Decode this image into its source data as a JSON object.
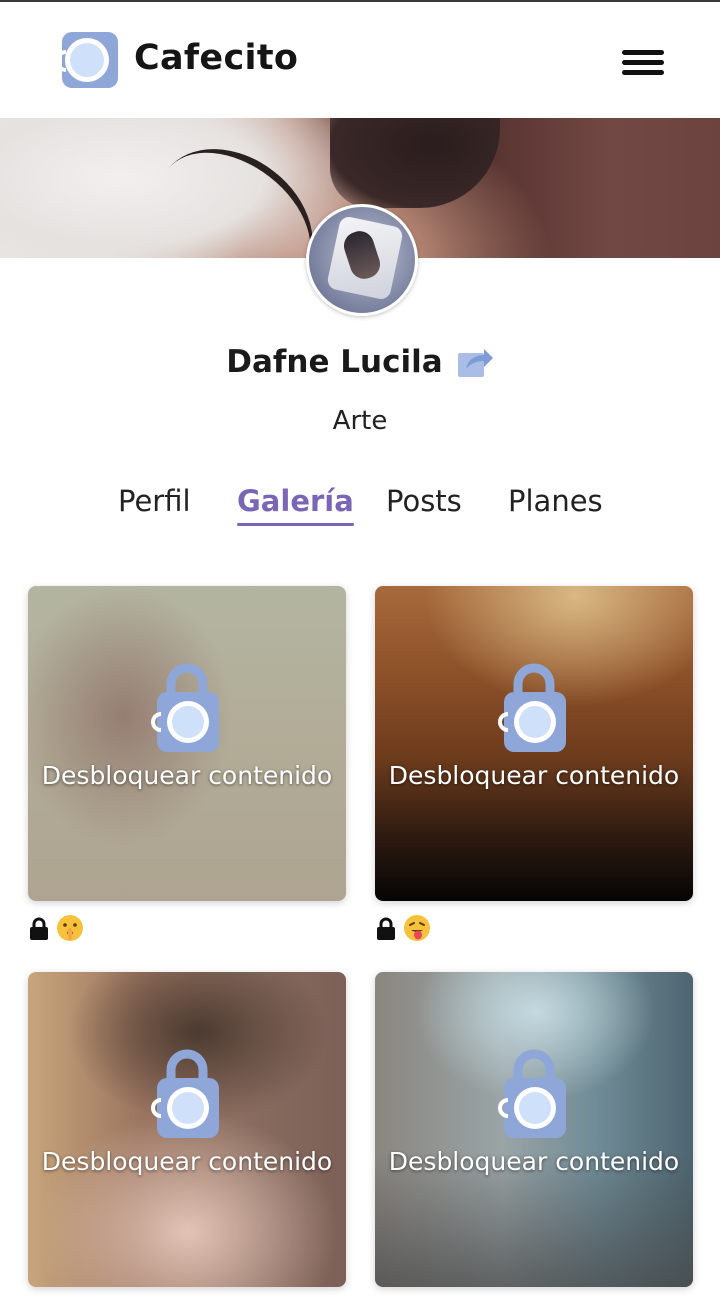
{
  "header": {
    "brand": "Cafecito",
    "logo_icon": "cafecito-cup-icon",
    "menu_icon": "hamburger-menu-icon"
  },
  "profile": {
    "name": "Dafne Lucila",
    "share_icon": "share-icon",
    "category": "Arte"
  },
  "tabs": [
    {
      "label": "Perfil",
      "active": false
    },
    {
      "label": "Galería",
      "active": true
    },
    {
      "label": "Posts",
      "active": false
    },
    {
      "label": "Planes",
      "active": false
    }
  ],
  "gallery": [
    {
      "unlock_label": "Desbloquear contenido",
      "lock_icon": "padlock-icon",
      "emoji": "shushing-face-emoji"
    },
    {
      "unlock_label": "Desbloquear contenido",
      "lock_icon": "padlock-icon",
      "emoji": "tongue-out-face-emoji"
    },
    {
      "unlock_label": "Desbloquear contenido"
    },
    {
      "unlock_label": "Desbloquear contenido"
    }
  ],
  "colors": {
    "accent": "#7b66b5",
    "logo_blue": "#8fa6d8",
    "logo_light": "#cfe0fb"
  }
}
